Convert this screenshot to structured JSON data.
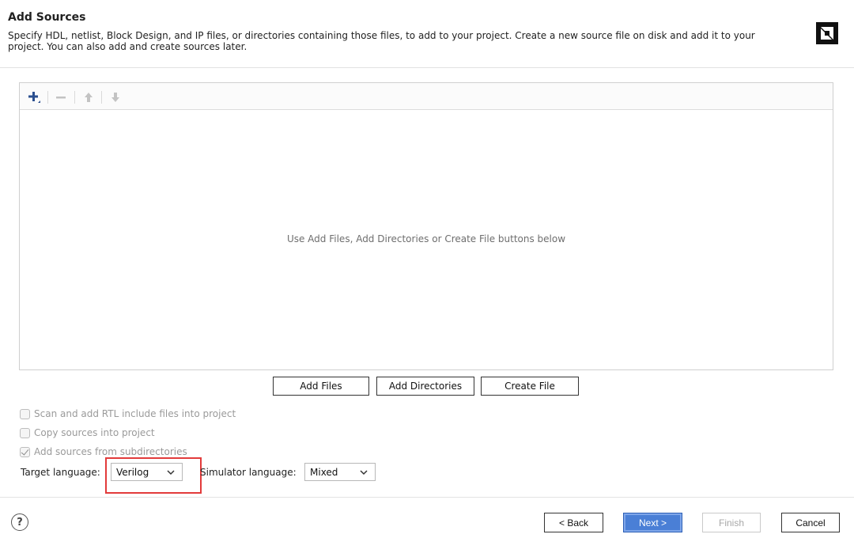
{
  "header": {
    "title": "Add Sources",
    "description": "Specify HDL, netlist, Block Design, and IP files, or directories containing those files, to add to your project. Create a new source file on disk and add it to your project. You can also add and create sources later.",
    "logo_icon": "amd-logo-icon"
  },
  "panel": {
    "toolbar": [
      "add-icon",
      "remove-icon",
      "move-up-icon",
      "move-down-icon"
    ],
    "empty_text": "Use Add Files, Add Directories or Create File buttons below"
  },
  "actions": {
    "add_files": "Add Files",
    "add_directories": "Add Directories",
    "create_file": "Create File"
  },
  "options": {
    "scan_rtl": {
      "label": "Scan and add RTL include files into project",
      "checked": false
    },
    "copy_sources": {
      "label": "Copy sources into project",
      "checked": false
    },
    "add_subdirs": {
      "label": "Add sources from subdirectories",
      "checked": true
    }
  },
  "languages": {
    "target_label": "Target language:",
    "target_value": "Verilog",
    "simulator_label": "Simulator language:",
    "simulator_value": "Mixed"
  },
  "footer": {
    "help": "?",
    "back": "< Back",
    "next": "Next >",
    "finish": "Finish",
    "cancel": "Cancel"
  },
  "colors": {
    "primary": "#4a7fd6",
    "highlight": "#e23b3b"
  }
}
